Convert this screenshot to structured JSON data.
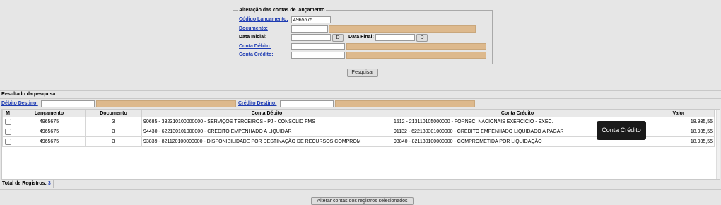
{
  "filter": {
    "legend": "Alteração das contas de lançamento",
    "codigo_label": "Código Lançamento:",
    "codigo_value": "4965675",
    "documento_label": "Documento:",
    "data_inicial_label": "Data Inicial:",
    "data_final_label": "Data Final:",
    "date_button": "D",
    "conta_debito_label": "Conta Débito:",
    "conta_credito_label": "Conta Crédito:",
    "search_button": "Pesquisar"
  },
  "results": {
    "section_title": "Resultado da pesquisa",
    "debito_destino_label": "Débito Destino:",
    "credito_destino_label": "Crédito Destino:",
    "columns": [
      "M",
      "Lançamento",
      "Documento",
      "Conta Débito",
      "Conta Crédito",
      "Valor"
    ],
    "rows": [
      {
        "lancamento": "4965675",
        "documento": "3",
        "debito": "90685 - 332310100000000 - SERVIÇOS TERCEIROS - PJ - CONSOLID FMS",
        "credito": "1512 - 213110105000000 - FORNEC. NACIONAIS EXERCICIO - EXEC.",
        "valor": "18.935,55"
      },
      {
        "lancamento": "4965675",
        "documento": "3",
        "debito": "94430 - 622130101000000 - CREDITO EMPENHADO A LIQUIDAR",
        "credito": "91132 - 622130301000000 - CREDITO EMPENHADO LIQUIDADO A PAGAR",
        "valor": "18.935,55"
      },
      {
        "lancamento": "4965675",
        "documento": "3",
        "debito": "93839 - 821120100000000 - DISPONIBILIDADE POR DESTINAÇÃO DE RECURSOS COMPROM",
        "credito": "93840 - 821130100000000 - COMPROMETIDA POR LIQUIDAÇÃO",
        "valor": "18.935,55"
      }
    ],
    "total_label": "Total de Registros:",
    "total_value": "3",
    "tooltip": "Conta Crédito",
    "alter_button": "Alterar contas dos registros selecionados"
  }
}
